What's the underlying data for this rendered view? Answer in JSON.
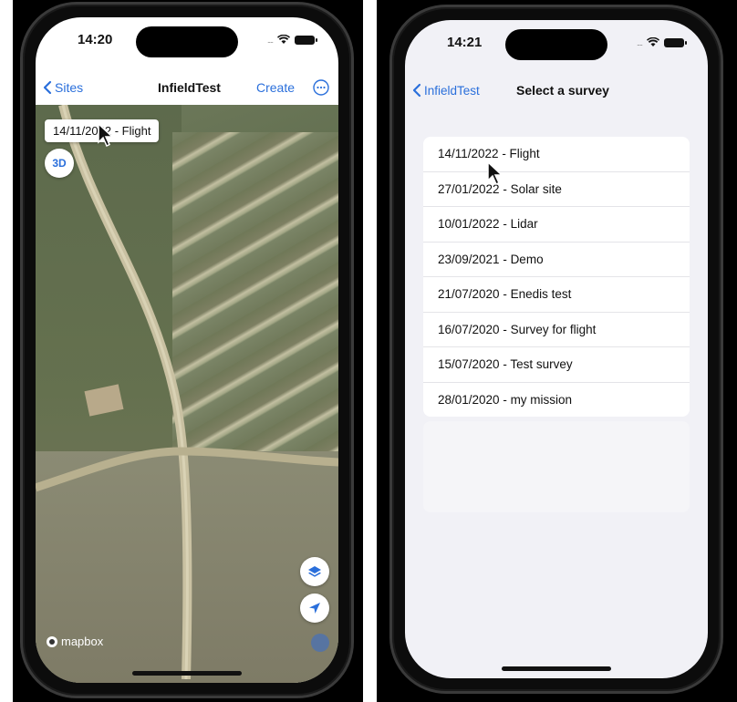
{
  "left": {
    "time": "14:20",
    "nav": {
      "back_label": "Sites",
      "title": "InfieldTest",
      "create_label": "Create"
    },
    "map": {
      "survey_chip": "14/11/2022 - Flight",
      "btn_3d": "3D",
      "logo_text": "mapbox",
      "icons": [
        "layers-icon",
        "location-arrow-icon",
        "info-icon"
      ]
    }
  },
  "right": {
    "time": "14:21",
    "nav": {
      "back_label": "InfieldTest",
      "title": "Select a survey"
    },
    "surveys": [
      "14/11/2022 - Flight",
      "27/01/2022 - Solar site",
      "10/01/2022 - Lidar",
      "23/09/2021 - Demo",
      "21/07/2020 - Enedis test",
      "16/07/2020 - Survey for flight",
      "15/07/2020 - Test survey",
      "28/01/2020 - my mission"
    ]
  },
  "colors": {
    "accent": "#2a6fdb",
    "list_bg": "#f1f1f6"
  }
}
